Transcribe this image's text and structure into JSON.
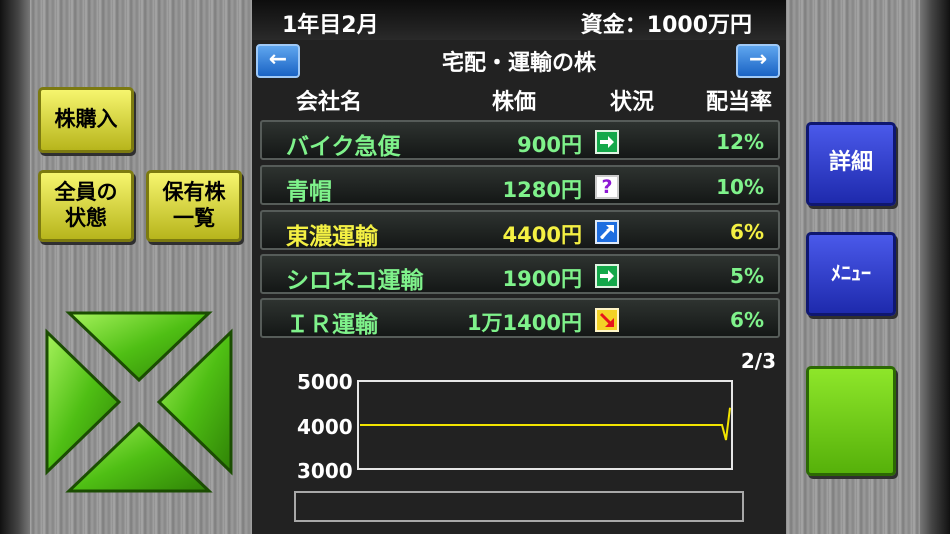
{
  "header": {
    "date": "1年目2月",
    "funds": "資金：1000万円"
  },
  "nav": {
    "prev": "←",
    "next": "→",
    "category": "宅配・運輸の株"
  },
  "columns": {
    "company": "会社名",
    "price": "株価",
    "status": "状況",
    "dividend": "配当率"
  },
  "stocks": [
    {
      "name": "バイク急便",
      "price": "900円",
      "status": "flat-arrow-icon",
      "dividend": "12%"
    },
    {
      "name": "青帽",
      "price": "1280円",
      "status": "question-icon",
      "dividend": "10%"
    },
    {
      "name": "東濃運輸",
      "price": "4400円",
      "status": "up-arrow-icon",
      "dividend": "6%"
    },
    {
      "name": "シロネコ運輸",
      "price": "1900円",
      "status": "flat-arrow-icon",
      "dividend": "5%"
    },
    {
      "name": "ＩＲ運輸",
      "price": "1万1400円",
      "status": "down-arrow-icon",
      "dividend": "6%"
    }
  ],
  "status_question_mark": "?",
  "selected_row": 2,
  "page_indicator": "2/3",
  "left_buttons": {
    "buy": "株購入",
    "all_status_1": "全員の",
    "all_status_2": "状態",
    "holdings_1": "保有株",
    "holdings_2": "一覧"
  },
  "right_buttons": {
    "detail": "詳細",
    "menu": "ﾒﾆｭｰ"
  },
  "colors": {
    "accent_yellow": "#f4f043",
    "text_green": "#7ff28b",
    "button_blue": "#2c3ad0",
    "button_green": "#6ccc14",
    "chart_line": "#f2e400"
  },
  "chart_data": {
    "type": "line",
    "title": "",
    "xlabel": "",
    "ylabel": "",
    "ylim": [
      3000,
      5000
    ],
    "yticks": [
      "5000",
      "4000",
      "3000"
    ],
    "grid": false,
    "series": [
      {
        "values": [
          4000,
          4000,
          4000,
          4000,
          4000,
          4000,
          4000,
          4000,
          4000,
          4000,
          4000,
          4000,
          4000,
          4000,
          4000,
          4000,
          4000,
          4000,
          4000,
          4000,
          4000,
          4000,
          4000,
          4000,
          4000,
          4000,
          4000,
          4000,
          4000,
          4000,
          4000,
          4000,
          4000,
          4000,
          4000,
          4000,
          4000,
          4000,
          4000,
          4000,
          4000,
          4000,
          4000,
          4000,
          4000,
          4000,
          4000,
          4000,
          4000,
          4000,
          4000,
          4000,
          4000,
          4000,
          4000,
          4000,
          4000,
          4000,
          4000,
          4000,
          4000,
          4000,
          4000,
          4000,
          4000,
          4000,
          4000,
          4000,
          4000,
          4000,
          4000,
          4000,
          4000,
          4000,
          4000,
          4000,
          4000,
          4000,
          4000,
          4000,
          4000,
          4000,
          4000,
          4000,
          4000,
          4000,
          4000,
          4000,
          4000,
          4000,
          4000,
          3650,
          4400
        ]
      }
    ]
  }
}
